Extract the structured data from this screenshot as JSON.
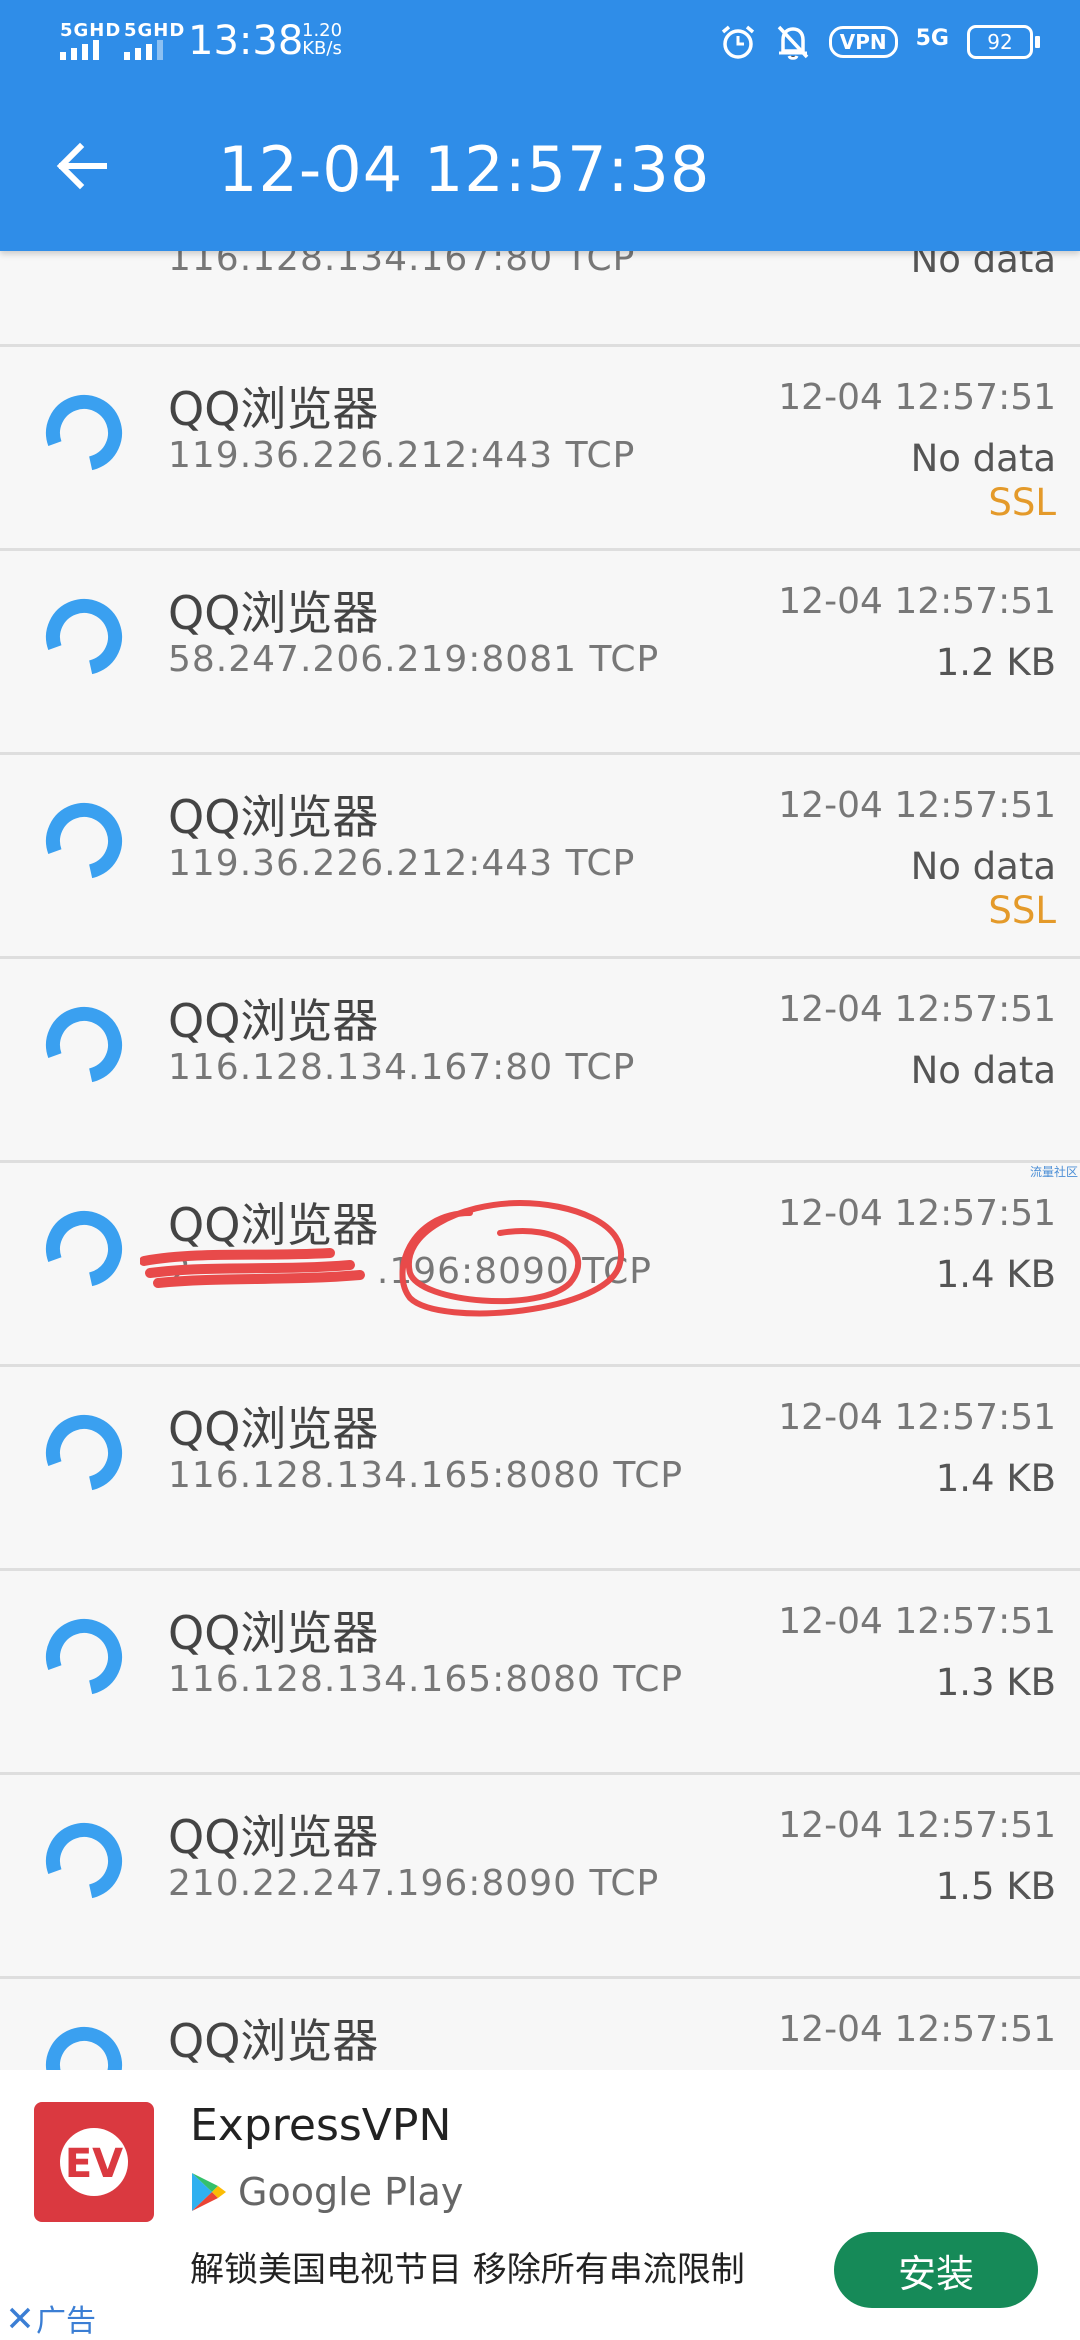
{
  "status_bar": {
    "sim1": "5GHD",
    "sim2": "5GHD",
    "time": "13:38",
    "speed_value": "1.20",
    "speed_unit": "KB/s",
    "vpn": "VPN",
    "net": "5G",
    "battery": "92"
  },
  "header": {
    "title": "12-04 12:57:38"
  },
  "partial_row": {
    "addr": "116.128.134.167:80   TCP",
    "size": "No data"
  },
  "connections": [
    {
      "app": "QQ浏览器",
      "addr": "119.36.226.212:443   TCP",
      "time": "12-04 12:57:51",
      "size": "No data",
      "ssl": "SSL"
    },
    {
      "app": "QQ浏览器",
      "addr": "58.247.206.219:8081   TCP",
      "time": "12-04 12:57:51",
      "size": "1.2 KB",
      "ssl": ""
    },
    {
      "app": "QQ浏览器",
      "addr": "119.36.226.212:443   TCP",
      "time": "12-04 12:57:51",
      "size": "No data",
      "ssl": "SSL"
    },
    {
      "app": "QQ浏览器",
      "addr": "116.128.134.167:80   TCP",
      "time": "12-04 12:57:51",
      "size": "No data",
      "ssl": ""
    },
    {
      "app": "QQ浏览器",
      "addr": "2     .196:8090   TCP",
      "time": "12-04 12:57:51",
      "size": "1.4 KB",
      "ssl": ""
    },
    {
      "app": "QQ浏览器",
      "addr": "116.128.134.165:8080   TCP",
      "time": "12-04 12:57:51",
      "size": "1.4 KB",
      "ssl": ""
    },
    {
      "app": "QQ浏览器",
      "addr": "116.128.134.165:8080   TCP",
      "time": "12-04 12:57:51",
      "size": "1.3 KB",
      "ssl": ""
    },
    {
      "app": "QQ浏览器",
      "addr": "210.22.247.196:8090   TCP",
      "time": "12-04 12:57:51",
      "size": "1.5 KB",
      "ssl": ""
    },
    {
      "app": "QQ浏览器",
      "addr": "",
      "time": "12-04 12:57:51",
      "size": "",
      "ssl": ""
    }
  ],
  "watermark": "流量社区",
  "ad": {
    "app_name": "ExpressVPN",
    "store": "Google Play",
    "logo_text": "EV",
    "description": "解锁美国电视节目 移除所有串流限制",
    "install": "安装",
    "label": "广告"
  },
  "colors": {
    "appbar": "#2f8de8",
    "ssl": "#e49a2a",
    "install": "#168a58",
    "ad_logo": "#da3940"
  }
}
